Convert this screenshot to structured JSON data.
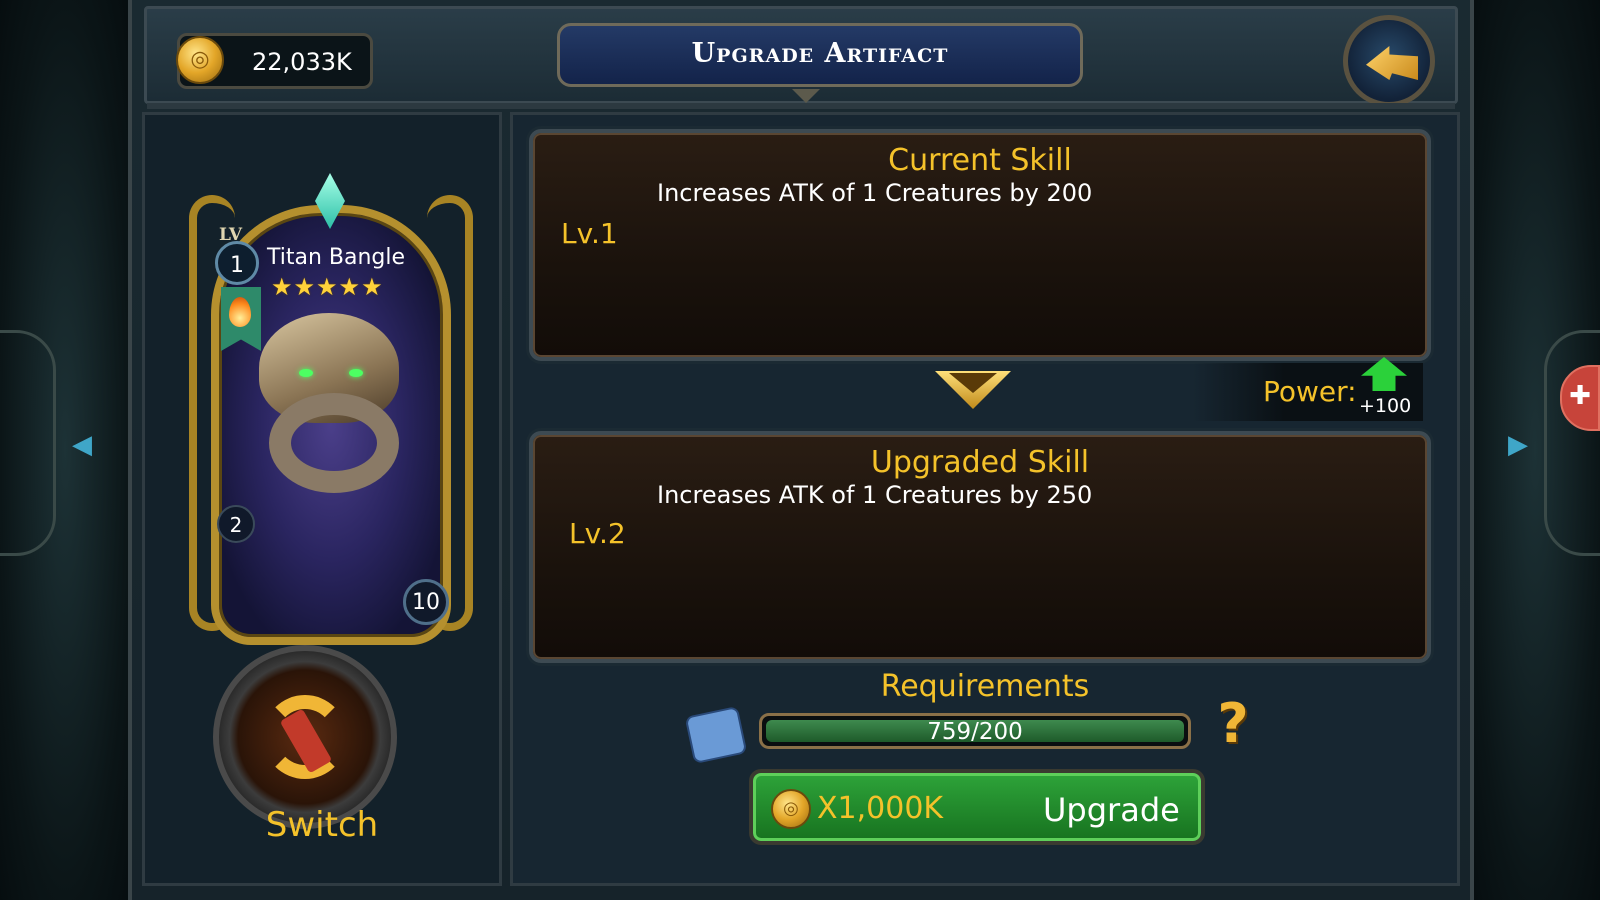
{
  "header": {
    "title": "Upgrade Artifact",
    "gold_amount": "22,033K",
    "back_icon": "back-arrow-icon"
  },
  "artifact": {
    "lv_tag": "LV",
    "level": "1",
    "name": "Titan Bangle",
    "stars": 5,
    "stars_display": "★★★★★",
    "left_count": "2",
    "right_count": "10"
  },
  "switch": {
    "label": "Switch"
  },
  "current_skill": {
    "title": "Current Skill",
    "description": "Increases ATK of 1 Creatures by 200",
    "level": "Lv.1"
  },
  "upgraded_skill": {
    "title": "Upgraded Skill",
    "description": "Increases ATK of 1 Creatures by 250",
    "level": "Lv.2"
  },
  "power": {
    "label": "Power:",
    "value": "+100"
  },
  "requirements": {
    "title": "Requirements",
    "progress_text": "759/200",
    "progress_fraction": 1.0
  },
  "upgrade": {
    "cost": "X1,000K",
    "label": "Upgrade"
  },
  "colors": {
    "accent_gold": "#f4c22a",
    "button_green": "#2ea43a",
    "power_up_green": "#2bd13a"
  }
}
